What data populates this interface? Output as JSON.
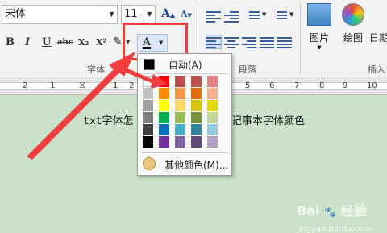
{
  "font": {
    "name": "宋体",
    "size": "11"
  },
  "format_buttons": [
    "B",
    "I",
    "U",
    "abc",
    "X₂",
    "X²"
  ],
  "grow_font": "A",
  "shrink_font": "A",
  "font_color_button": "A",
  "groups": {
    "font_partial": "字体",
    "paragraph": "段落",
    "insert": "插入"
  },
  "insert": {
    "picture": "图片",
    "drawing": "绘图",
    "date_partial": "日期"
  },
  "ruler": {
    "numbers": [
      "2",
      "1",
      "1",
      "2",
      "3",
      "4",
      "5",
      "6",
      "7",
      "8",
      "9",
      "10"
    ]
  },
  "document": {
    "left_text": "txt字体怎",
    "right_text": "记事本字体颜色"
  },
  "color_popup": {
    "automatic_label": "自动(A)",
    "more_colors_label": "其他颜色(M)...",
    "columns": [
      [
        "#ffffff",
        "#c0c0c0",
        "#a0a0a0",
        "#808080",
        "#404040",
        "#000000"
      ],
      [
        "#ff0000",
        "#ff8c00",
        "#ffff00",
        "#00b050",
        "#0070c0",
        "#7030a0"
      ],
      [
        "#c0504d",
        "#f79646",
        "#ffd966",
        "#9bbb59",
        "#4bacc6",
        "#8064a2"
      ],
      [
        "#c0504d",
        "#e36c09",
        "#d8c400",
        "#77933c",
        "#31859b",
        "#5f497a"
      ],
      [
        "#e08080",
        "#f7b28d",
        "#e3d70d",
        "#c3d69b",
        "#93cddd",
        "#b3a2c7"
      ]
    ]
  },
  "highlight_color": "#f03e3e",
  "watermark": {
    "brand": "Bai",
    "product": "经验",
    "url": "jingyan.baidu.com"
  }
}
